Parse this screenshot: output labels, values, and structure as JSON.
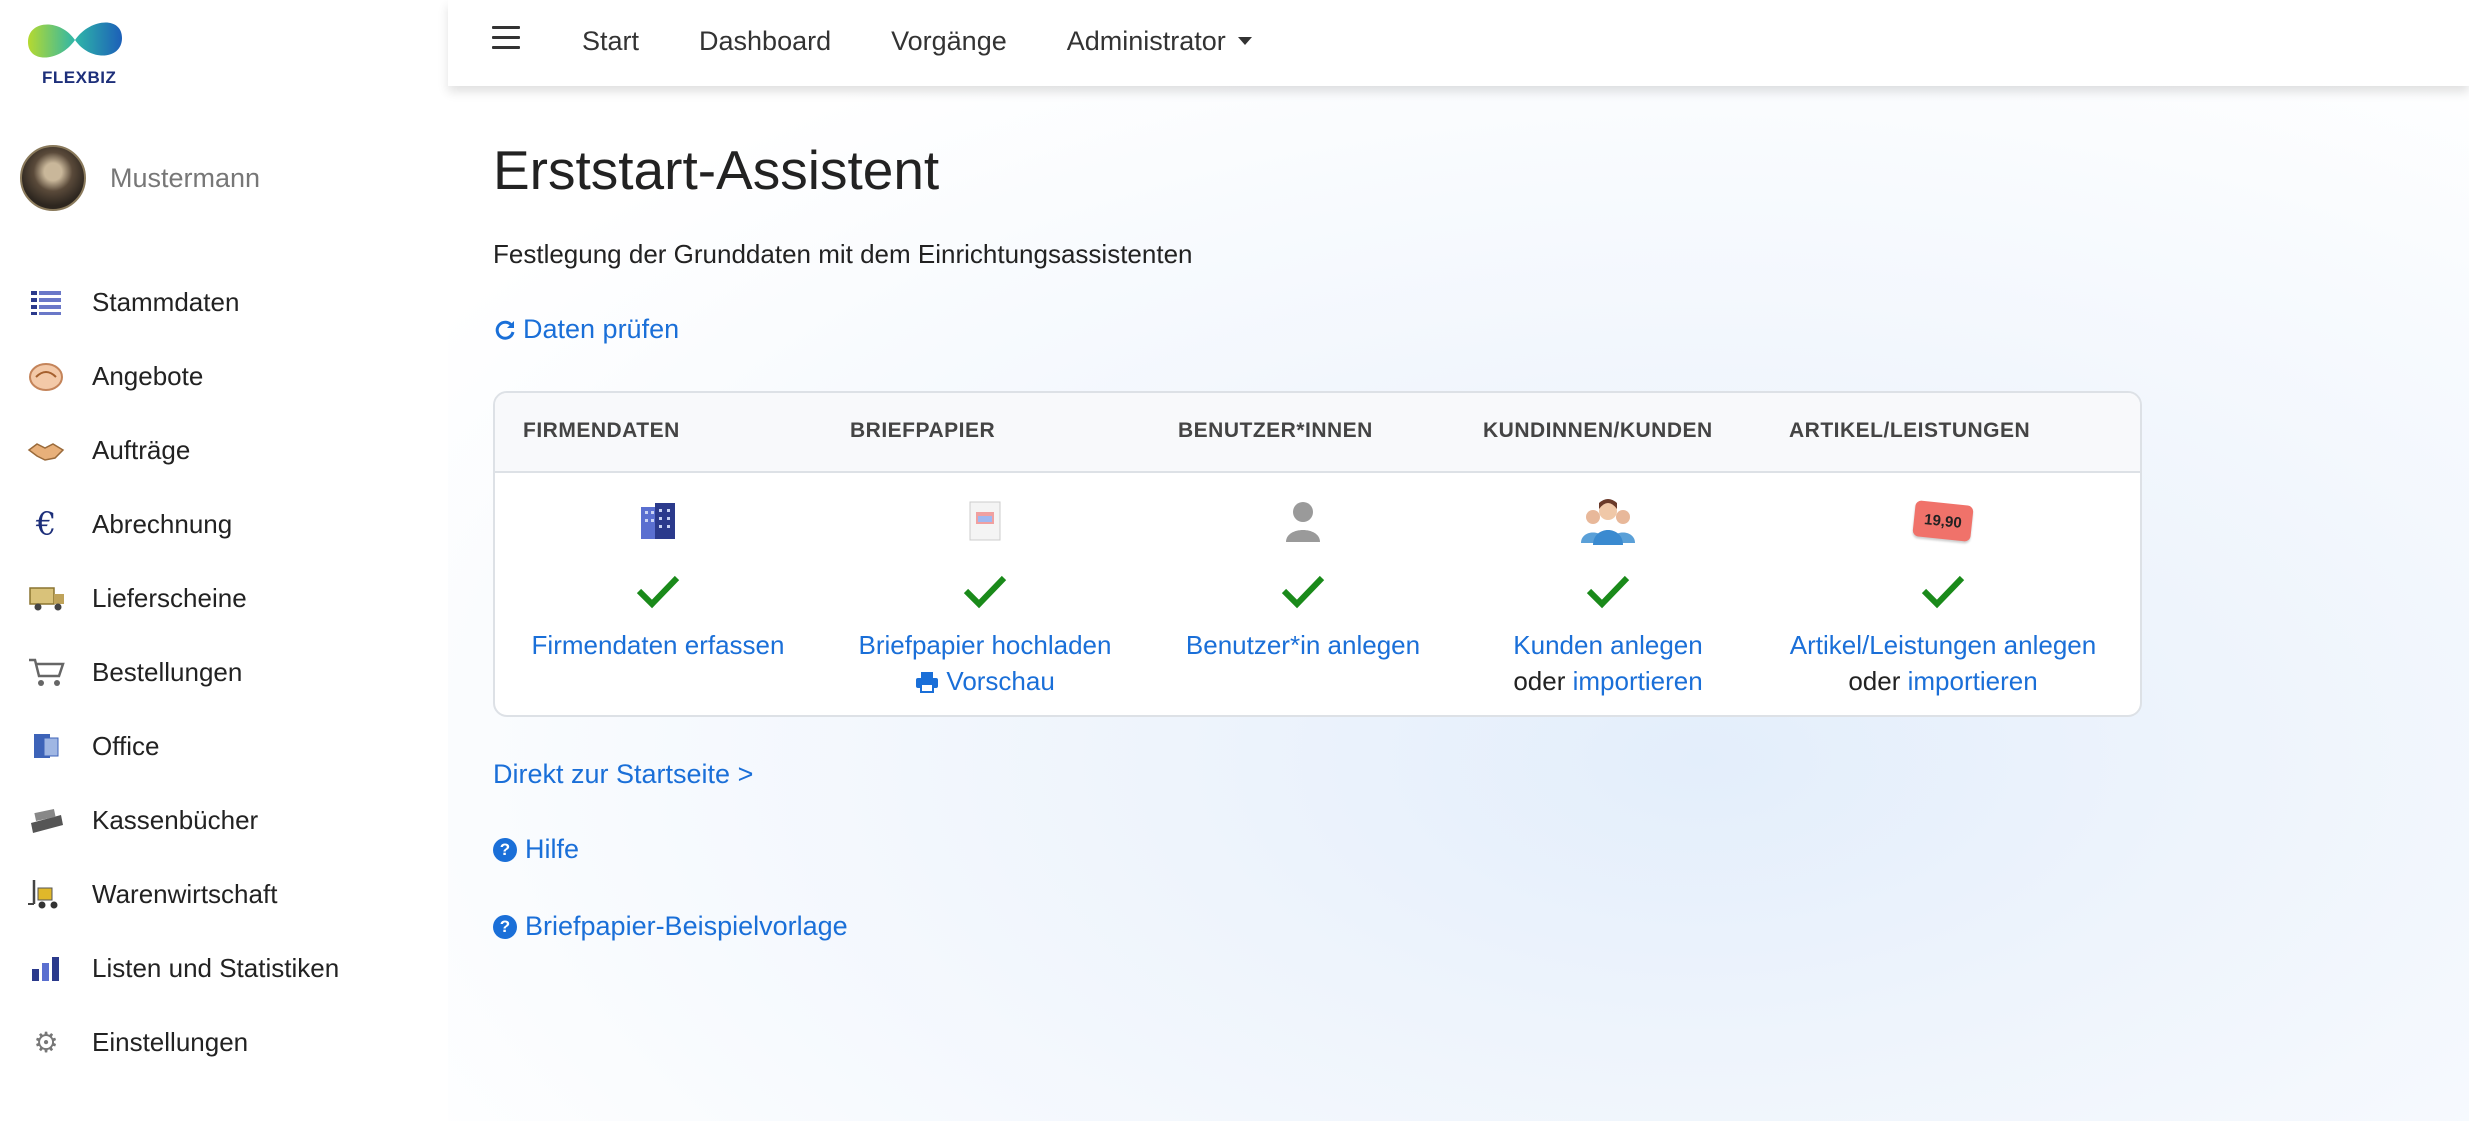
{
  "brand": {
    "name": "FLEXBIZ"
  },
  "user": {
    "name": "Mustermann"
  },
  "sidebar": {
    "items": [
      {
        "label": "Stammdaten",
        "icon": "list-icon"
      },
      {
        "label": "Angebote",
        "icon": "offer-icon"
      },
      {
        "label": "Aufträge",
        "icon": "handshake-icon"
      },
      {
        "label": "Abrechnung",
        "icon": "euro-icon"
      },
      {
        "label": "Lieferscheine",
        "icon": "truck-icon"
      },
      {
        "label": "Bestellungen",
        "icon": "cart-icon"
      },
      {
        "label": "Office",
        "icon": "office-icon"
      },
      {
        "label": "Kassenbücher",
        "icon": "cash-register-icon"
      },
      {
        "label": "Warenwirtschaft",
        "icon": "forklift-icon"
      },
      {
        "label": "Listen und Statistiken",
        "icon": "bar-chart-icon"
      },
      {
        "label": "Einstellungen",
        "icon": "gear-icon"
      }
    ]
  },
  "topnav": {
    "items": [
      "Start",
      "Dashboard",
      "Vorgänge",
      "Administrator"
    ]
  },
  "page": {
    "title": "Erststart-Assistent",
    "subtitle": "Festlegung der Grunddaten mit dem Einrichtungsassistenten",
    "check_label": "Daten prüfen"
  },
  "wizard": {
    "columns": [
      {
        "header": "FIRMENDATEN",
        "icon": "building-icon",
        "action": "Firmendaten erfassen",
        "second": ""
      },
      {
        "header": "BRIEFPAPIER",
        "icon": "letterhead-icon",
        "action": "Briefpapier hochladen",
        "second": "Vorschau"
      },
      {
        "header": "BENUTZER*INNEN",
        "icon": "user-icon",
        "action": "Benutzer*in anlegen",
        "second": ""
      },
      {
        "header": "KUNDINNEN/KUNDEN",
        "icon": "customers-icon",
        "action": "Kunden anlegen",
        "or": "oder",
        "second": "importieren"
      },
      {
        "header": "ARTIKEL/LEISTUNGEN",
        "icon": "price-tag-icon",
        "price_tag": "19,90",
        "action": "Artikel/Leistungen anlegen",
        "or": "oder",
        "second": "importieren"
      }
    ],
    "check_color": "#1a8a1a"
  },
  "links": {
    "startseite": "Direkt zur Startseite >",
    "hilfe": "Hilfe",
    "vorlage": "Briefpapier-Beispielvorlage"
  },
  "colors": {
    "link": "#1a6fd8",
    "accent_navy": "#1d2f7a"
  }
}
